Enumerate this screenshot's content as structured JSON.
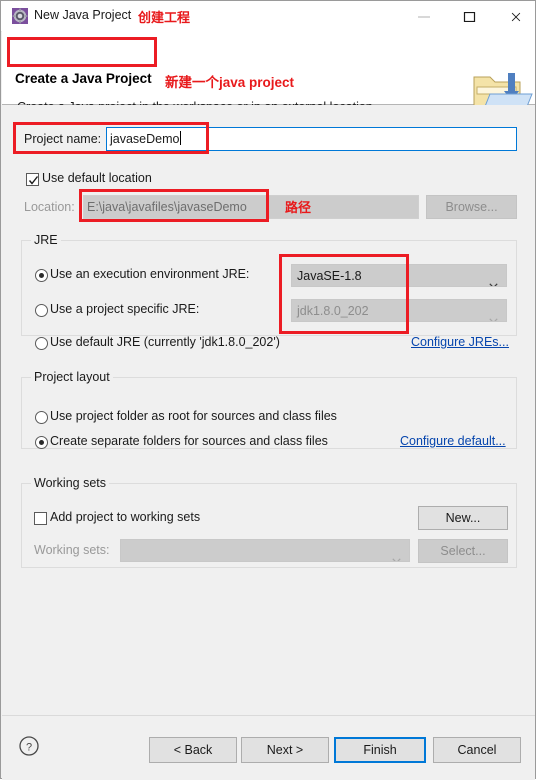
{
  "window": {
    "title": "New Java Project",
    "title_icon": "java-project-gear-icon",
    "annotation_title": "创建工程",
    "minimize_label": "minimize-icon",
    "maximize_label": "maximize-icon",
    "close_label": "close-icon"
  },
  "header": {
    "title": "Create a Java Project",
    "annotation_title": "新建一个java project",
    "subtitle": "Create a Java project in the workspace or in an external location.",
    "banner_icon": "new-java-project-folder-icon"
  },
  "project": {
    "name_label": "Project name:",
    "name_value": "javaseDemo",
    "use_default_location_label": "Use default location",
    "use_default_location_checked": true,
    "location_label": "Location:",
    "location_value": "E:\\java\\javafiles\\javaseDemo",
    "location_annotation": "路径",
    "browse_label": "Browse..."
  },
  "jre": {
    "group_title": "JRE",
    "option_execution_env": "Use an execution environment JRE:",
    "option_execution_env_selected": true,
    "execution_env_value": "JavaSE-1.8",
    "option_project_specific": "Use a project specific JRE:",
    "option_project_specific_selected": false,
    "project_specific_value": "jdk1.8.0_202",
    "option_default_jre": "Use default JRE (currently 'jdk1.8.0_202')",
    "option_default_jre_selected": false,
    "configure_link": "Configure JREs..."
  },
  "layout": {
    "group_title": "Project layout",
    "option_project_folder": "Use project folder as root for sources and class files",
    "option_project_folder_selected": false,
    "option_separate_folders": "Create separate folders for sources and class files",
    "option_separate_folders_selected": true,
    "configure_link": "Configure default..."
  },
  "working_sets": {
    "group_title": "Working sets",
    "add_label": "Add project to working sets",
    "add_checked": false,
    "new_button": "New...",
    "working_sets_label": "Working sets:",
    "working_sets_value": "",
    "select_button": "Select..."
  },
  "footer": {
    "help_icon": "help-question-icon",
    "back_label": "< Back",
    "next_label": "Next >",
    "finish_label": "Finish",
    "cancel_label": "Cancel"
  },
  "colors": {
    "dialog_bg": "#f0f0f0",
    "annotation_red": "#ec1c24",
    "accent_blue": "#0078d7",
    "link_blue": "#0645ad"
  }
}
